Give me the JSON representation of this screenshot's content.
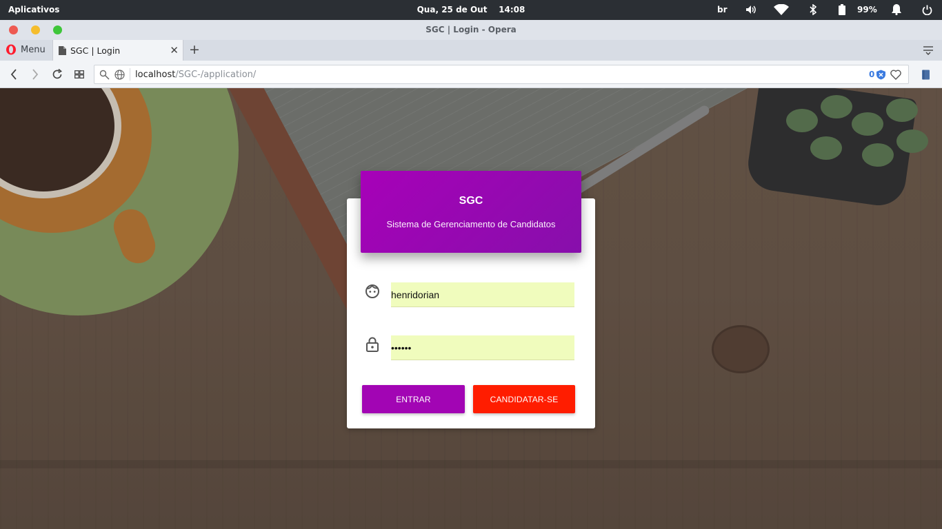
{
  "system_bar": {
    "apps_label": "Aplicativos",
    "date": "Qua, 25 de Out",
    "time": "14:08",
    "keyboard_layout": "br",
    "battery_percent": "99%"
  },
  "window": {
    "title": "SGC | Login - Opera",
    "traffic_lights": [
      "#ee5a52",
      "#f5bd2d",
      "#3ec63a"
    ]
  },
  "tabs": {
    "menu_label": "Menu",
    "active_tab_title": "SGC | Login"
  },
  "address_bar": {
    "host": "localhost",
    "path": "/SGC-/application/",
    "blocked_count": "0"
  },
  "login": {
    "title": "SGC",
    "subtitle": "Sistema de Gerenciamento de Candidatos",
    "username_value": "henridorian",
    "password_value": "••••••",
    "enter_button": "ENTRAR",
    "apply_button": "CANDIDATAR-SE"
  },
  "colors": {
    "header_start": "#a701b8",
    "header_end": "#870fab",
    "enter_button": "#a205b4",
    "apply_button": "#ff1d00",
    "input_fill": "#f0fcbd"
  }
}
